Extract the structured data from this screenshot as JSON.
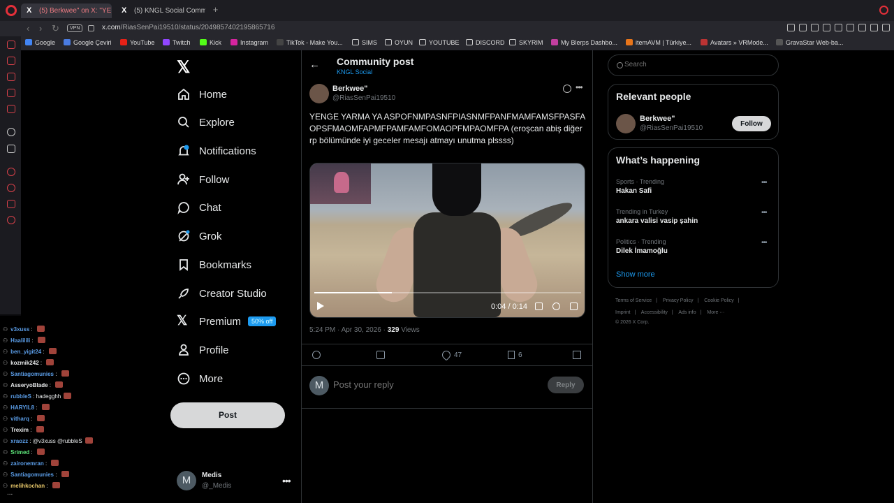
{
  "browser": {
    "tabs": [
      {
        "label": "(5) Berkwee\" on X: \"YENG",
        "active": true
      },
      {
        "label": "(5) KNGL Social Communit",
        "active": false
      }
    ],
    "vpn_label": "VPN",
    "url_host": "x.com",
    "url_path": "/RiasSenPai19510/status/2049857402195865716",
    "bookmarks": [
      "Google",
      "Google Çeviri",
      "YouTube",
      "Twitch",
      "Kick",
      "Instagram",
      "TikTok - Make You...",
      "SIMS",
      "OYUN",
      "YOUTUBE",
      "DISCORD",
      "SKYRIM",
      "My Blerps Dashbo...",
      "itemAVM | Türkiye...",
      "Avatars » VRMode...",
      "GravaStar Web-ba..."
    ]
  },
  "nav": {
    "items": [
      "Home",
      "Explore",
      "Notifications",
      "Follow",
      "Chat",
      "Grok",
      "Bookmarks",
      "Creator Studio",
      "Premium",
      "Profile",
      "More"
    ],
    "premium_badge": "50% off",
    "post_button": "Post",
    "account": {
      "initial": "M",
      "name": "Medis",
      "handle": "@_Medis"
    }
  },
  "chat": [
    {
      "user": "v3xuss",
      "color": "#5a9ce6",
      "msg": ""
    },
    {
      "user": "Haalilili",
      "color": "#5a9ce6",
      "msg": ""
    },
    {
      "user": "ben_yigit24",
      "color": "#5a9ce6",
      "msg": ""
    },
    {
      "user": "kozmik242",
      "color": "#e7e9ea",
      "msg": ""
    },
    {
      "user": "Santiagomunies",
      "color": "#5a9ce6",
      "msg": ""
    },
    {
      "user": "AsseryoBlade",
      "color": "#e7e9ea",
      "msg": ""
    },
    {
      "user": "rubbleS",
      "color": "#5a9ce6",
      "msg": "hadegghh"
    },
    {
      "user": "HARYIL8",
      "color": "#5a9ce6",
      "msg": ""
    },
    {
      "user": "vitharq",
      "color": "#5a9ce6",
      "msg": ""
    },
    {
      "user": "Trexim",
      "color": "#e7e9ea",
      "msg": ""
    },
    {
      "user": "xraozz",
      "color": "#5a9ce6",
      "msg": "@v3xuss @rubbleS"
    },
    {
      "user": "Srimed",
      "color": "#5ee87b",
      "msg": ""
    },
    {
      "user": "zaironemran",
      "color": "#5a9ce6",
      "msg": ""
    },
    {
      "user": "Santiagomunies",
      "color": "#5a9ce6",
      "msg": ""
    },
    {
      "user": "melihkochan",
      "color": "#e8c86a",
      "msg": ""
    }
  ],
  "chat_more": "...",
  "post": {
    "header_title": "Community post",
    "header_sub": "KNGL Social",
    "author_name": "Berkwee\"",
    "author_handle": "@RiasSenPai19510",
    "text": "YENGE YARMA YA ASPOFNMPASNFPIASNMFPANFMAMFAMSFPASFAOPSFMAOMFAPMFPAMFAMFOMAOPFMPAOMFPA (eroşcan abiş diğer rp bölümünde iyi geceler mesajı atmayı unutma plssss)",
    "video_time": "0:04 / 0:14",
    "video_progress": 0.29,
    "timestamp": "5:24 PM · Apr 30, 2026 · ",
    "views_count": "329",
    "views_label": " Views",
    "likes": "47",
    "bookmarks": "6",
    "reply_initial": "M",
    "reply_placeholder": "Post your reply",
    "reply_button": "Reply"
  },
  "right": {
    "search_placeholder": "Search",
    "relevant_title": "Relevant people",
    "relevant": {
      "name": "Berkwee\"",
      "handle": "@RiasSenPai19510",
      "follow": "Follow"
    },
    "happening_title": "What’s happening",
    "trends": [
      {
        "category": "Sports · Trending",
        "name": "Hakan Safi"
      },
      {
        "category": "Trending in Turkey",
        "name": "ankara valisi vasip şahin"
      },
      {
        "category": "Politics · Trending",
        "name": "Dilek İmamoğlu"
      }
    ],
    "show_more": "Show more",
    "footer_row1": [
      "Terms of Service",
      "|",
      "Privacy Policy",
      "|",
      "Cookie Policy",
      "|"
    ],
    "footer_row2": [
      "Imprint",
      "|",
      "Accessibility",
      "|",
      "Ads info",
      "|",
      "More ···"
    ],
    "footer_row3": "© 2026 X Corp."
  }
}
